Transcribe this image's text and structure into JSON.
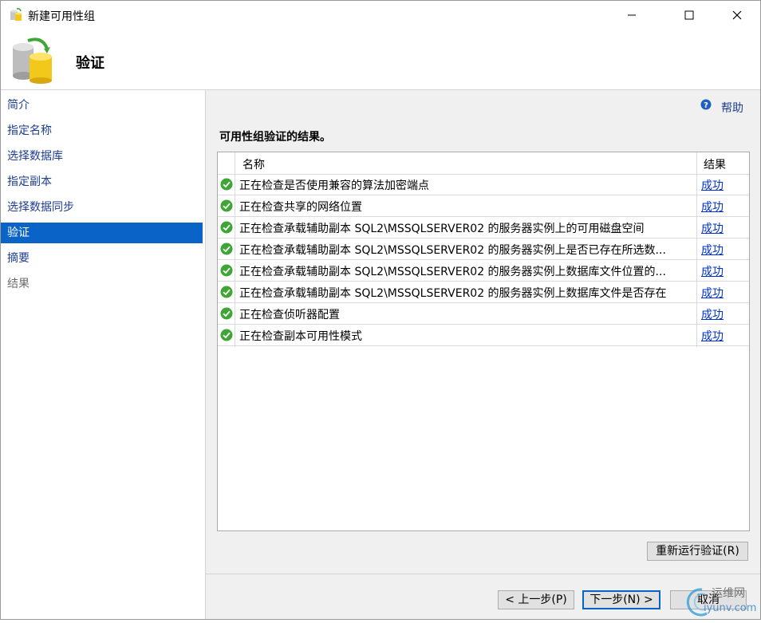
{
  "window": {
    "title": "新建可用性组"
  },
  "header": {
    "title": "验证"
  },
  "sidebar": {
    "items": [
      {
        "label": "简介",
        "state": "normal"
      },
      {
        "label": "指定名称",
        "state": "normal"
      },
      {
        "label": "选择数据库",
        "state": "normal"
      },
      {
        "label": "指定副本",
        "state": "normal"
      },
      {
        "label": "选择数据同步",
        "state": "normal"
      },
      {
        "label": "验证",
        "state": "active"
      },
      {
        "label": "摘要",
        "state": "normal"
      },
      {
        "label": "结果",
        "state": "disabled"
      }
    ]
  },
  "content": {
    "help_label": "帮助",
    "heading": "可用性组验证的结果。",
    "grid": {
      "columns": {
        "name": "名称",
        "result": "结果"
      },
      "rows": [
        {
          "message": "正在检查是否使用兼容的算法加密端点",
          "result": "成功"
        },
        {
          "message": "正在检查共享的网络位置",
          "result": "成功"
        },
        {
          "message": "正在检查承载辅助副本 SQL2\\MSSQLSERVER02 的服务器实例上的可用磁盘空间",
          "result": "成功"
        },
        {
          "message": "正在检查承载辅助副本 SQL2\\MSSQLSERVER02 的服务器实例上是否已存在所选数...",
          "result": "成功"
        },
        {
          "message": "正在检查承载辅助副本 SQL2\\MSSQLSERVER02 的服务器实例上数据库文件位置的...",
          "result": "成功"
        },
        {
          "message": "正在检查承载辅助副本 SQL2\\MSSQLSERVER02 的服务器实例上数据库文件是否存在",
          "result": "成功"
        },
        {
          "message": "正在检查侦听器配置",
          "result": "成功"
        },
        {
          "message": "正在检查副本可用性模式",
          "result": "成功"
        }
      ]
    },
    "rerun_label": "重新运行验证(R)"
  },
  "footer": {
    "prev_label": "< 上一步(P)",
    "next_label": "下一步(N) >",
    "cancel_label": "取消"
  },
  "watermark": {
    "text_cn": "运维网",
    "text_en": "iyunv.com"
  },
  "colors": {
    "accent": "#0a64c8",
    "link": "#0033cc",
    "success": "#3fa636"
  }
}
